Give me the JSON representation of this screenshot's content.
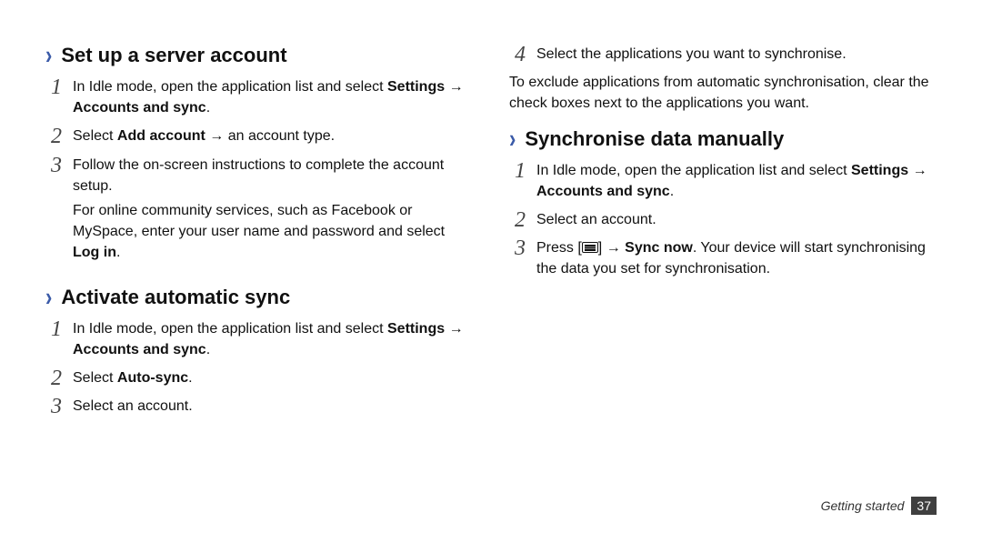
{
  "leftColumn": {
    "section1": {
      "heading": "Set up a server account",
      "steps": {
        "s1": {
          "num": "1",
          "pre": "In Idle mode, open the application list and select ",
          "path": "Settings → Accounts and sync",
          "post": "."
        },
        "s2": {
          "num": "2",
          "pre": "Select ",
          "bold": "Add account",
          "post": " → an account type."
        },
        "s3": {
          "num": "3",
          "line1": "Follow the on-screen instructions to complete the account setup.",
          "line2pre": "For online community services, such as Facebook or MySpace, enter your user name and password and select ",
          "line2bold": "Log in",
          "line2post": "."
        }
      }
    },
    "section2": {
      "heading": "Activate automatic sync",
      "steps": {
        "s1": {
          "num": "1",
          "pre": "In Idle mode, open the application list and select ",
          "path": "Settings → Accounts and sync",
          "post": "."
        },
        "s2": {
          "num": "2",
          "pre": "Select ",
          "bold": "Auto-sync",
          "post": "."
        },
        "s3": {
          "num": "3",
          "text": "Select an account."
        }
      }
    }
  },
  "rightColumn": {
    "continuation": {
      "num": "4",
      "text": "Select the applications you want to synchronise."
    },
    "note": "To exclude applications from automatic synchronisation, clear the check boxes next to the applications you want.",
    "section3": {
      "heading": "Synchronise data manually",
      "steps": {
        "s1": {
          "num": "1",
          "pre": "In Idle mode, open the application list and select ",
          "path": "Settings → Accounts and sync",
          "post": "."
        },
        "s2": {
          "num": "2",
          "text": "Select an account."
        },
        "s3": {
          "num": "3",
          "pre": "Press [",
          "mid": "] → ",
          "bold": "Sync now",
          "post": ". Your device will start synchronising the data you set for synchronisation."
        }
      }
    }
  },
  "footer": {
    "label": "Getting started",
    "page": "37"
  }
}
